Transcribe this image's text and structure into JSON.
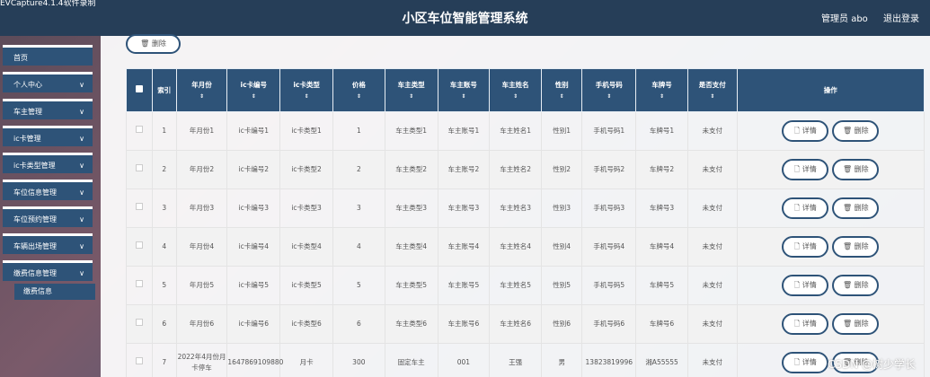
{
  "capture_label": "EVCapture4.1.4软件录制",
  "header": {
    "title": "小区车位智能管理系统",
    "user": "管理员 abo",
    "logout": "退出登录"
  },
  "sidebar": {
    "items": [
      {
        "label": "首页",
        "chevron": ""
      },
      {
        "label": "个人中心",
        "chevron": "∨"
      },
      {
        "label": "车主管理",
        "chevron": "∨"
      },
      {
        "label": "ic卡管理",
        "chevron": "∨"
      },
      {
        "label": "ic卡类型管理",
        "chevron": "∨"
      },
      {
        "label": "车位信息管理",
        "chevron": "∨"
      },
      {
        "label": "车位预约管理",
        "chevron": "∨"
      },
      {
        "label": "车辆出场管理",
        "chevron": "∨"
      },
      {
        "label": "缴费信息管理",
        "chevron": "∨"
      }
    ],
    "sub_item": "缴费信息"
  },
  "toolbar": {
    "delete_label": "🗑 删除"
  },
  "table": {
    "headers": [
      "索引",
      "年月份",
      "ic卡编号",
      "ic卡类型",
      "价格",
      "车主类型",
      "车主账号",
      "车主姓名",
      "性别",
      "手机号码",
      "车牌号",
      "是否支付",
      "操作"
    ],
    "sort_marks": [
      "",
      "⇕",
      "⇕",
      "⇕",
      "⇕",
      "⇕",
      "⇕",
      "⇕",
      "⇕",
      "⇕",
      "⇕",
      "⇕",
      ""
    ],
    "detail_label": "🗋 详情",
    "delete_label": "🗑 删除",
    "rows": [
      [
        "1",
        "年月份1",
        "ic卡编号1",
        "ic卡类型1",
        "1",
        "车主类型1",
        "车主账号1",
        "车主姓名1",
        "性别1",
        "手机号码1",
        "车牌号1",
        "未支付"
      ],
      [
        "2",
        "年月份2",
        "ic卡编号2",
        "ic卡类型2",
        "2",
        "车主类型2",
        "车主账号2",
        "车主姓名2",
        "性别2",
        "手机号码2",
        "车牌号2",
        "未支付"
      ],
      [
        "3",
        "年月份3",
        "ic卡编号3",
        "ic卡类型3",
        "3",
        "车主类型3",
        "车主账号3",
        "车主姓名3",
        "性别3",
        "手机号码3",
        "车牌号3",
        "未支付"
      ],
      [
        "4",
        "年月份4",
        "ic卡编号4",
        "ic卡类型4",
        "4",
        "车主类型4",
        "车主账号4",
        "车主姓名4",
        "性别4",
        "手机号码4",
        "车牌号4",
        "未支付"
      ],
      [
        "5",
        "年月份5",
        "ic卡编号5",
        "ic卡类型5",
        "5",
        "车主类型5",
        "车主账号5",
        "车主姓名5",
        "性别5",
        "手机号码5",
        "车牌号5",
        "未支付"
      ],
      [
        "6",
        "年月份6",
        "ic卡编号6",
        "ic卡类型6",
        "6",
        "车主类型6",
        "车主账号6",
        "车主姓名6",
        "性别6",
        "手机号码6",
        "车牌号6",
        "未支付"
      ],
      [
        "7",
        "2022年4月份月卡停车",
        "1647869109880",
        "月卡",
        "300",
        "固定车主",
        "001",
        "王强",
        "男",
        "13823819996",
        "湘A55555",
        "未支付"
      ]
    ]
  },
  "watermark": "CSDN @树少学长"
}
